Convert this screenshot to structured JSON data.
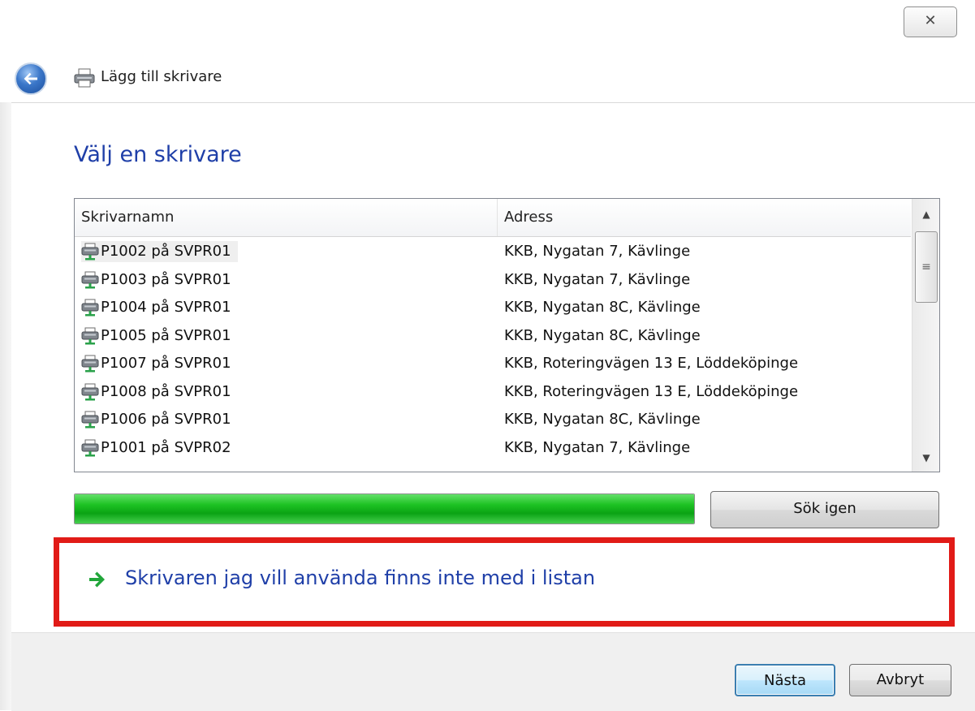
{
  "window": {
    "title": "Lägg till skrivare",
    "close_glyph": "✕"
  },
  "page": {
    "heading": "Välj en skrivare"
  },
  "list": {
    "columns": [
      "Skrivarnamn",
      "Adress"
    ],
    "rows": [
      {
        "name": "P1002 på SVPR01",
        "address": "KKB, Nygatan 7, Kävlinge"
      },
      {
        "name": "P1003 på SVPR01",
        "address": "KKB, Nygatan 7, Kävlinge"
      },
      {
        "name": "P1004 på SVPR01",
        "address": "KKB, Nygatan 8C, Kävlinge"
      },
      {
        "name": "P1005 på SVPR01",
        "address": "KKB, Nygatan 8C, Kävlinge"
      },
      {
        "name": "P1007 på SVPR01",
        "address": "KKB, Roteringvägen 13 E, Löddeköpinge"
      },
      {
        "name": "P1008 på SVPR01",
        "address": "KKB, Roteringvägen 13 E, Löddeköpinge"
      },
      {
        "name": "P1006 på SVPR01",
        "address": "KKB, Nygatan 8C, Kävlinge"
      },
      {
        "name": "P1001 på SVPR02",
        "address": "KKB, Nygatan 7, Kävlinge"
      }
    ]
  },
  "search": {
    "progress_fraction": 1.0,
    "button_label": "Sök igen"
  },
  "link": {
    "label": "Skrivaren jag vill använda finns inte med i listan"
  },
  "footer": {
    "next_label": "Nästa",
    "cancel_label": "Avbryt"
  },
  "icons": {
    "back": "back-arrow-icon",
    "printer": "printer-icon",
    "network_printer": "network-printer-icon",
    "link_arrow": "green-arrow-icon"
  },
  "colors": {
    "heading": "#1f3fa8",
    "highlight": "#e11b17",
    "progress": "#1ec324"
  }
}
